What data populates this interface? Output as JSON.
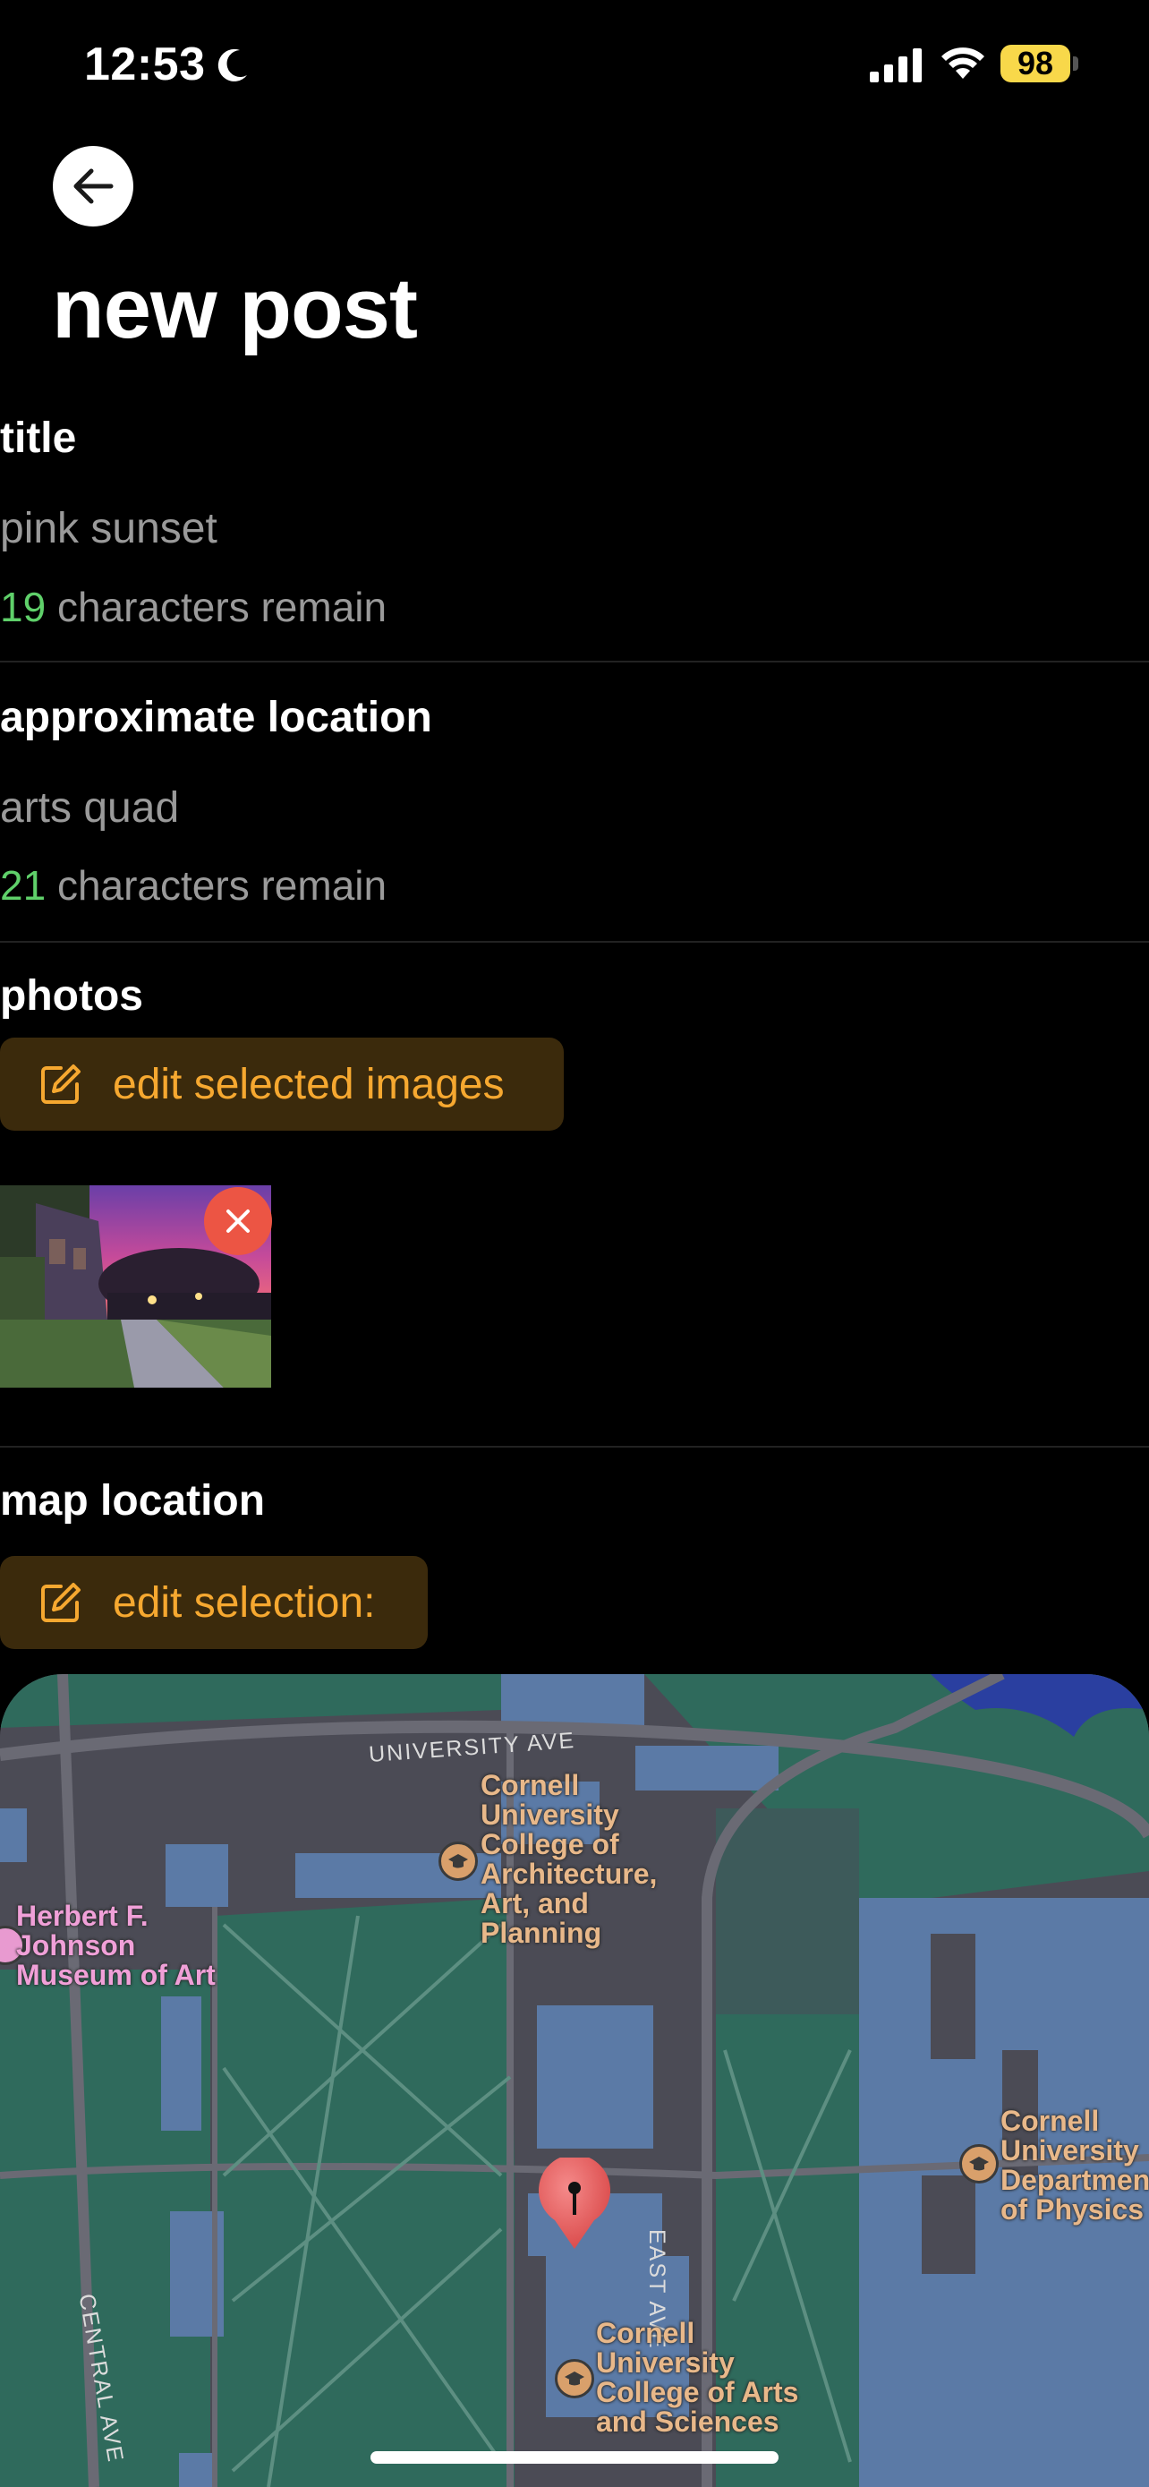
{
  "status_bar": {
    "time": "12:53",
    "battery": "98"
  },
  "header": {
    "title": "new post"
  },
  "title_section": {
    "label": "title",
    "value": "pink sunset",
    "remaining_count": "19",
    "remaining_text": " characters remain"
  },
  "location_section": {
    "label": "approximate location",
    "value": "arts quad",
    "remaining_count": "21",
    "remaining_text": " characters remain"
  },
  "photos_section": {
    "label": "photos",
    "edit_label": "edit selected images"
  },
  "map_section": {
    "label": "map location",
    "edit_label": "edit selection:",
    "streets": {
      "university": "UNIVERSITY AVE",
      "east": "EAST AVE",
      "central": "CENTRAL AVE"
    },
    "places": {
      "architecture": "Cornell\nUniversity\nCollege of\nArchitecture,\nArt, and\nPlanning",
      "museum": "Herbert F.\nJohnson\nMuseum of Art",
      "physics": "Cornell\nUniversity\nDepartment\nof Physics",
      "arts_sciences": "Cornell\nUniversity\nCollege of Arts\nand Sciences"
    }
  },
  "colors": {
    "accent": "#f6a830",
    "accent_bg": "#3b2a0c",
    "counter_ok": "#5fd06a",
    "remove": "#ec5544"
  }
}
